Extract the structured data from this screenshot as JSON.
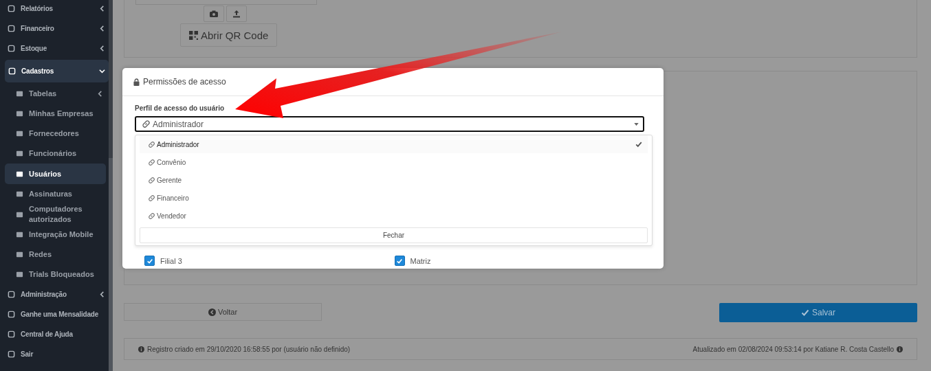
{
  "sidebar": {
    "items": [
      {
        "label": "Relatórios",
        "selected": false,
        "expanded": false,
        "has_submenu": true
      },
      {
        "label": "Financeiro",
        "selected": false,
        "expanded": false,
        "has_submenu": true
      },
      {
        "label": "Estoque",
        "selected": false,
        "expanded": false,
        "has_submenu": true
      },
      {
        "label": "Cadastros",
        "selected": true,
        "expanded": true,
        "has_submenu": true,
        "children": [
          {
            "label": "Tabelas",
            "selected": false,
            "has_submenu": true
          },
          {
            "label": "Minhas Empresas",
            "selected": false,
            "has_submenu": false
          },
          {
            "label": "Fornecedores",
            "selected": false,
            "has_submenu": false
          },
          {
            "label": "Funcionários",
            "selected": false,
            "has_submenu": false
          },
          {
            "label": "Usuários",
            "selected": true,
            "has_submenu": false
          },
          {
            "label": "Assinaturas",
            "selected": false,
            "has_submenu": false
          },
          {
            "label": "Computadores autorizados",
            "selected": false,
            "has_submenu": false
          },
          {
            "label": "Integração Mobile",
            "selected": false,
            "has_submenu": false
          },
          {
            "label": "Redes",
            "selected": false,
            "has_submenu": false
          },
          {
            "label": "Trials Bloqueados",
            "selected": false,
            "has_submenu": false
          }
        ]
      },
      {
        "label": "Administração",
        "selected": false,
        "expanded": false,
        "has_submenu": true
      },
      {
        "label": "Ganhe uma Mensalidade",
        "selected": false,
        "expanded": false,
        "has_submenu": false
      },
      {
        "label": "Central de Ajuda",
        "selected": false,
        "expanded": false,
        "has_submenu": false
      },
      {
        "label": "Sair",
        "selected": false,
        "expanded": false,
        "has_submenu": false
      }
    ]
  },
  "photo_panel": {
    "qr_button": "Abrir QR Code"
  },
  "modal": {
    "title": "Permissões de acesso",
    "field_label": "Perfil de acesso do usuário",
    "value": "Administrador",
    "options": [
      {
        "label": "Administrador",
        "selected": true
      },
      {
        "label": "Convênio",
        "selected": false
      },
      {
        "label": "Gerente",
        "selected": false
      },
      {
        "label": "Financeiro",
        "selected": false
      },
      {
        "label": "Vendedor",
        "selected": false
      }
    ],
    "close_button": "Fechar",
    "branches": [
      {
        "label": "Filial 3",
        "checked": true
      },
      {
        "label": "Matriz",
        "checked": true
      }
    ]
  },
  "actions": {
    "back": "Voltar",
    "save": "Salvar"
  },
  "footer": {
    "created": "Registro criado em 29/10/2020 16:58:55 por (usuário não definido)",
    "updated": "Atualizado em 02/08/2024 09:53:14 por Katiane R. Costa Castello"
  }
}
